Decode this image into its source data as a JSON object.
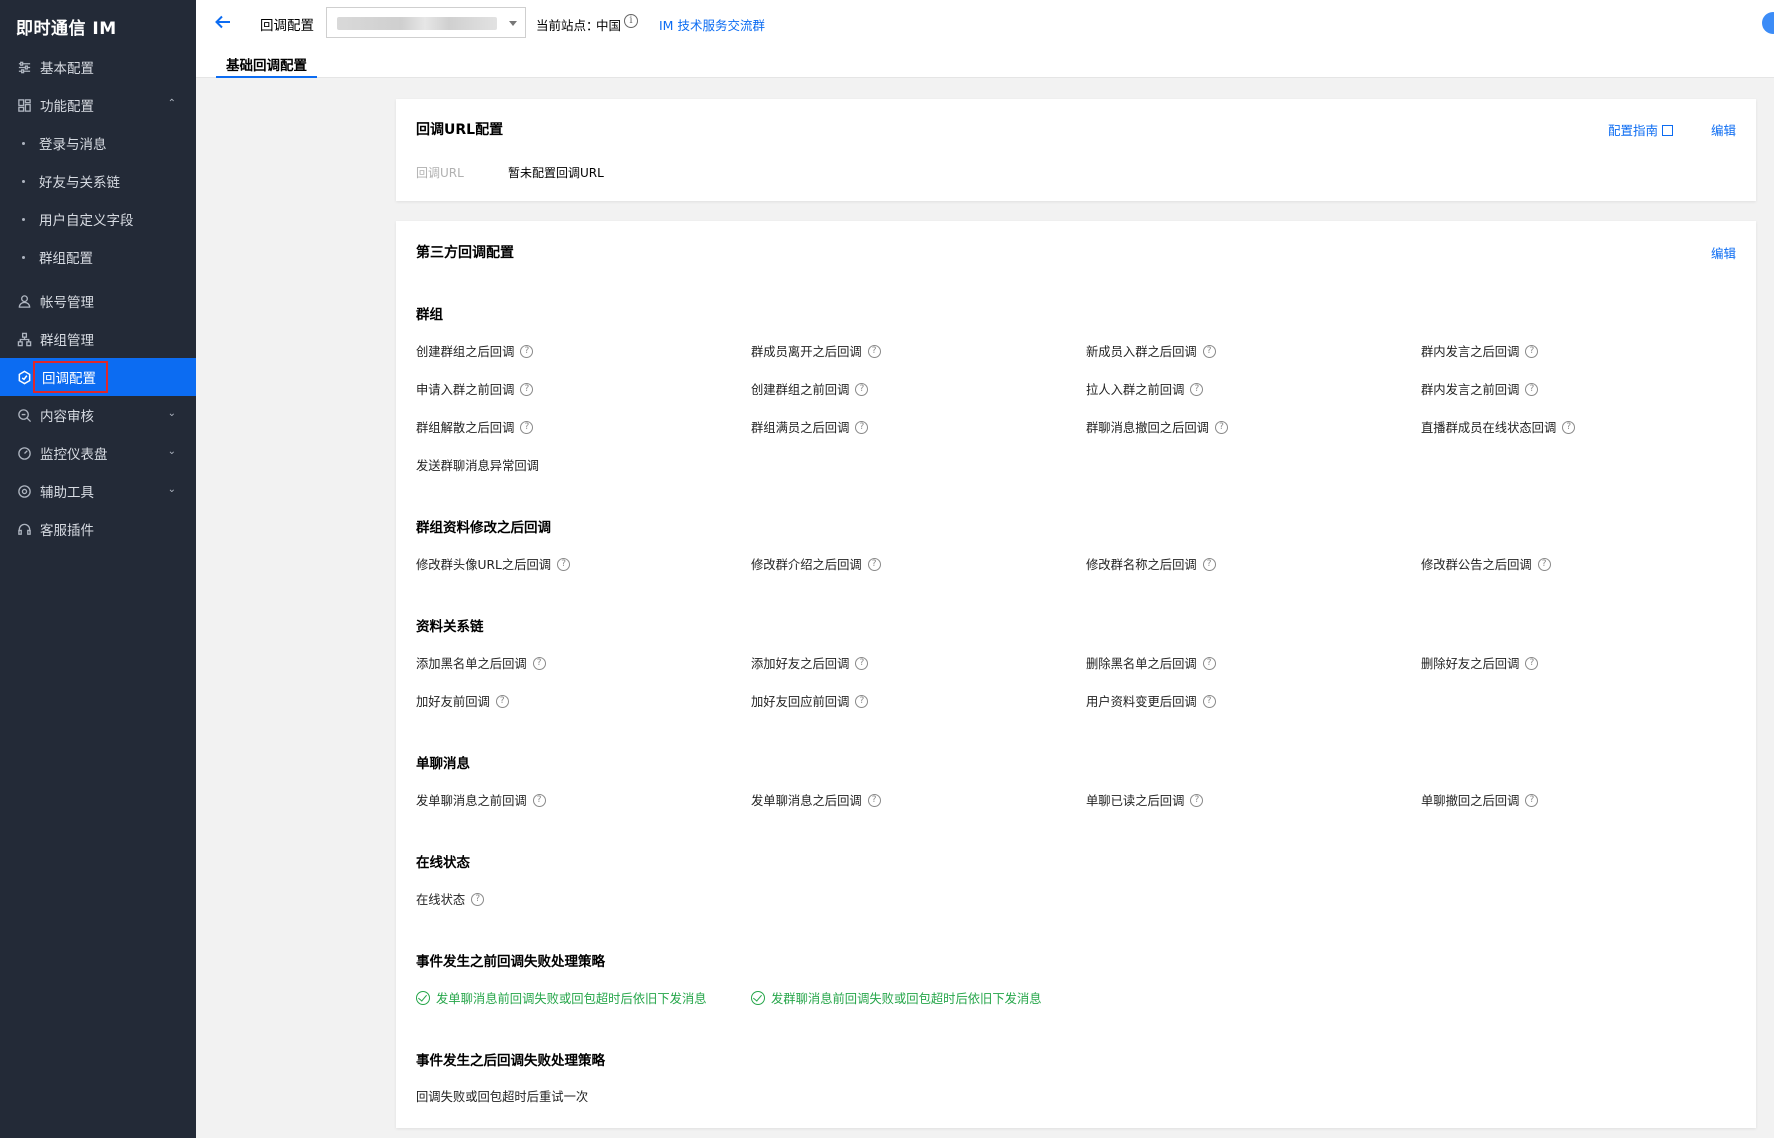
{
  "sidebar": {
    "brand": "即时通信 IM",
    "items": {
      "basic": "基本配置",
      "feature": "功能配置",
      "account": "帐号管理",
      "group_mgmt": "群组管理",
      "callback": "回调配置",
      "audit": "内容审核",
      "monitor": "监控仪表盘",
      "tools": "辅助工具",
      "service": "客服插件"
    },
    "sub_items": [
      "登录与消息",
      "好友与关系链",
      "用户自定义字段",
      "群组配置"
    ],
    "active_item": "回调配置"
  },
  "topbar": {
    "title": "回调配置",
    "site_label": "当前站点：",
    "site_value": "中国",
    "group_link": "IM 技术服务交流群",
    "tab": "基础回调配置"
  },
  "url_card": {
    "title": "回调URL配置",
    "guide_link": "配置指南",
    "edit_link": "编辑",
    "url_label": "回调URL",
    "url_value": "暂未配置回调URL"
  },
  "third_card": {
    "title": "第三方回调配置",
    "edit_link": "编辑",
    "sections": {
      "group": {
        "title": "群组",
        "items": [
          "创建群组之后回调",
          "群成员离开之后回调",
          "新成员入群之后回调",
          "群内发言之后回调",
          "申请入群之前回调",
          "创建群组之前回调",
          "拉人入群之前回调",
          "群内发言之前回调",
          "群组解散之后回调",
          "群组满员之后回调",
          "群聊消息撤回之后回调",
          "直播群成员在线状态回调",
          "发送群聊消息异常回调"
        ]
      },
      "group_profile": {
        "title": "群组资料修改之后回调",
        "items": [
          "修改群头像URL之后回调",
          "修改群介绍之后回调",
          "修改群名称之后回调",
          "修改群公告之后回调"
        ]
      },
      "relation": {
        "title": "资料关系链",
        "items": [
          "添加黑名单之后回调",
          "添加好友之后回调",
          "删除黑名单之后回调",
          "删除好友之后回调",
          "加好友前回调",
          "加好友回应前回调",
          "用户资料变更后回调"
        ]
      },
      "c2c": {
        "title": "单聊消息",
        "items": [
          "发单聊消息之前回调",
          "发单聊消息之后回调",
          "单聊已读之后回调",
          "单聊撤回之后回调"
        ]
      },
      "online": {
        "title": "在线状态",
        "items": [
          "在线状态"
        ]
      },
      "before_fail": {
        "title": "事件发生之前回调失败处理策略",
        "items": [
          "发单聊消息前回调失败或回包超时后依旧下发消息",
          "发群聊消息前回调失败或回包超时后依旧下发消息"
        ]
      },
      "after_fail": {
        "title": "事件发生之后回调失败处理策略",
        "text": "回调失败或回包超时后重试一次"
      }
    }
  },
  "colors": {
    "sidebar_bg": "#232a37",
    "active_bg": "#0c6cf2",
    "link": "#0c6cf2",
    "ok_green": "#26a64a",
    "highlight_border": "#e0282a"
  }
}
